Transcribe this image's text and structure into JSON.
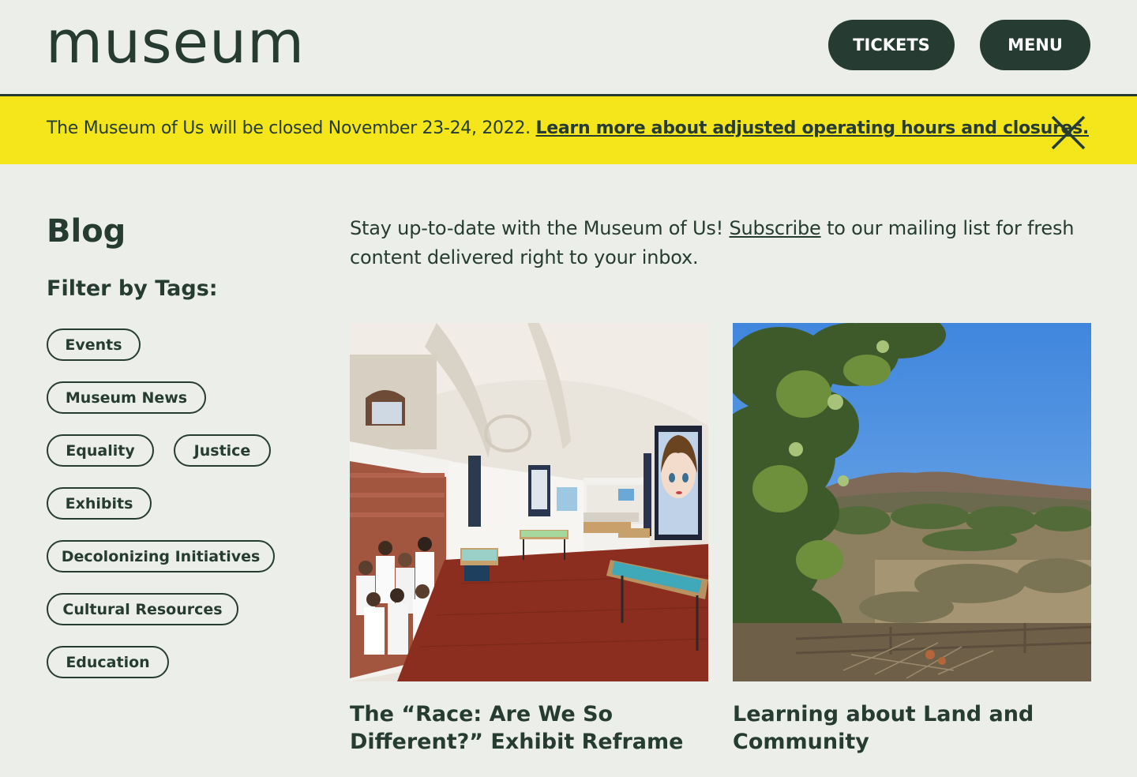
{
  "header": {
    "logo_text": "museum",
    "tickets_label": "TICKETS",
    "menu_label": "MENU"
  },
  "alert": {
    "message": "The Museum of Us will be closed November 23-24, 2022.",
    "link_text": "Learn more about adjusted operating hours and closures.",
    "close_icon": "close-x-icon",
    "background_color": "#f4e61a"
  },
  "sidebar": {
    "title": "Blog",
    "filter_heading": "Filter by Tags:",
    "tags": [
      "Events",
      "Museum News",
      "Equality",
      "Justice",
      "Exhibits",
      "Decolonizing Initiatives",
      "Cultural Resources",
      "Education"
    ]
  },
  "main": {
    "intro_before": "Stay up-to-date with the Museum of Us!",
    "intro_link": "Subscribe",
    "intro_after": "to our mailing list for fresh content delivered right to your inbox.",
    "posts": [
      {
        "title": "The “Race: Are We So Different?” Exhibit Reframe",
        "image": "museum-exhibit-hall-photo"
      },
      {
        "title": "Learning about Land and Community",
        "image": "landscape-hills-trees-photo"
      }
    ]
  },
  "colors": {
    "primary": "#263c33",
    "background": "#eceee9",
    "banner": "#f4e61a"
  }
}
